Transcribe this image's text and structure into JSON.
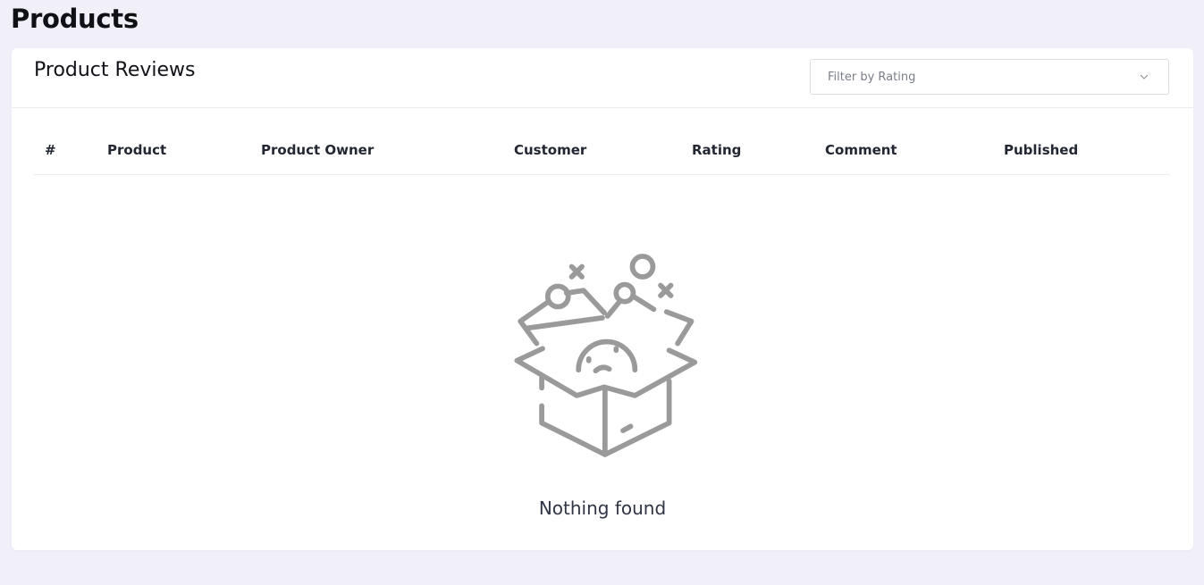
{
  "page": {
    "title": "Products"
  },
  "reviews_card": {
    "title": "Product Reviews",
    "filter": {
      "placeholder": "Filter by Rating",
      "icon": "chevron-down-icon"
    },
    "table": {
      "columns": [
        "#",
        "Product",
        "Product Owner",
        "Customer",
        "Rating",
        "Comment",
        "Published"
      ],
      "rows": []
    },
    "empty_state": {
      "icon": "empty-box-icon",
      "message": "Nothing found"
    }
  },
  "colors": {
    "background": "#f1eff8",
    "card": "#ffffff",
    "icon_gray": "#9a9a9a",
    "border": "#ececf0"
  }
}
